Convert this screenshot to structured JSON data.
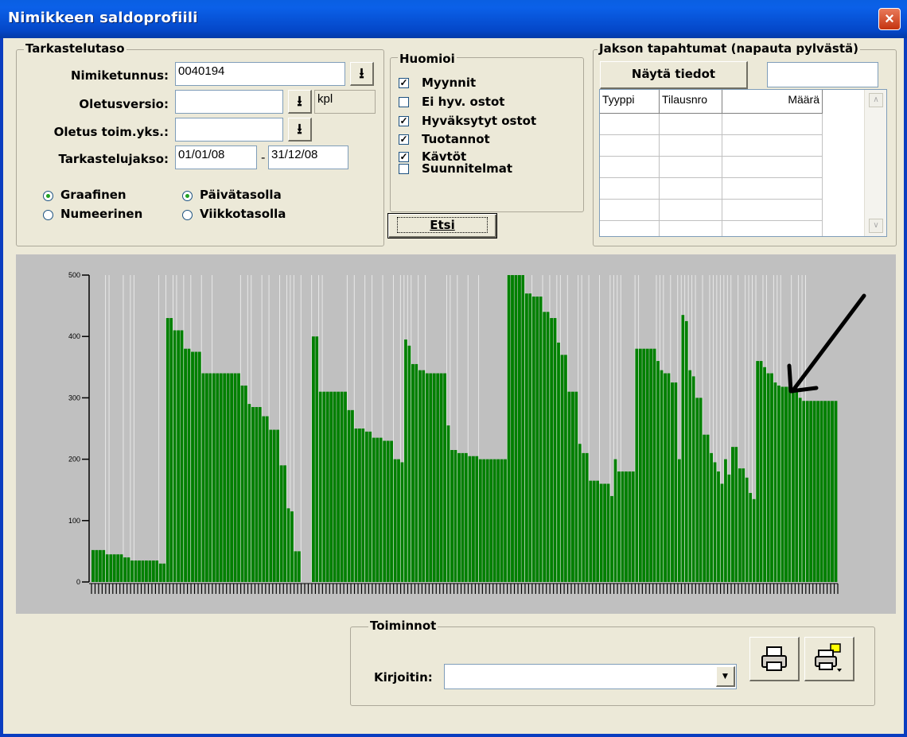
{
  "window": {
    "title": "Nimikkeen saldoprofiili",
    "close_glyph": "×"
  },
  "tarkastelutaso": {
    "legend": "Tarkastelutaso",
    "nimiketunnus_label": "Nimiketunnus:",
    "nimiketunnus_value": "0040194",
    "oletusversio_label": "Oletusversio:",
    "oletusversio_value": "",
    "unit_value": "kpl",
    "oletus_toimyks_label": "Oletus toim.yks.:",
    "oletus_toimyks_value": "",
    "jakso_label": "Tarkastelujakso:",
    "jakso_start": "01/01/08",
    "jakso_separator": "-",
    "jakso_end": "31/12/08",
    "radio_graafinen": "Graafinen",
    "radio_numeerinen": "Numeerinen",
    "radio_paivatasolla": "Päivätasolla",
    "radio_viikkotasolla": "Viikkotasolla",
    "selected_view": "Graafinen",
    "selected_level": "Päivätasolla",
    "download_glyph": "⭳"
  },
  "huomioi": {
    "legend": "Huomioi",
    "items": [
      {
        "label": "Myynnit",
        "checked": true
      },
      {
        "label": "Ei hyv. ostot",
        "checked": false
      },
      {
        "label": "Hyväksytyt ostot",
        "checked": true
      },
      {
        "label": "Tuotannot",
        "checked": true
      },
      {
        "label": "Kävtöt",
        "checked": true
      },
      {
        "label": "Suunnitelmat",
        "checked": false
      }
    ],
    "check_glyph": "✓",
    "search_button": "Etsi"
  },
  "jakson_tapahtumat": {
    "legend": "Jakson tapahtumat (napauta pylvästä)",
    "show_button": "Näytä tiedot",
    "info_value": "",
    "columns": [
      "Tyyppi",
      "Tilausnro",
      "Määrä"
    ],
    "rows": 6
  },
  "toiminnot": {
    "legend": "Toiminnot",
    "printer_label": "Kirjoitin:",
    "printer_value": "",
    "print_icon": "printer-icon",
    "printer_settings_icon": "printer-settings-icon"
  },
  "colors": {
    "bar": "#008000",
    "chart_bg": "#c0c0c0",
    "arrow": "#000000",
    "title_bar": "#0a5fe2"
  },
  "chart_data": {
    "type": "bar",
    "title": "",
    "xlabel": "",
    "ylabel": "",
    "ylim": [
      0,
      500
    ],
    "yticks": [
      "0",
      "100",
      "200",
      "300",
      "400",
      "500"
    ],
    "grid": false,
    "segments": [
      {
        "days": 4,
        "value": 52
      },
      {
        "days": 1,
        "value": 45
      },
      {
        "days": 4,
        "value": 45
      },
      {
        "days": 2,
        "value": 40
      },
      {
        "days": 1,
        "value": 35
      },
      {
        "days": 7,
        "value": 35
      },
      {
        "days": 2,
        "value": 30
      },
      {
        "days": 2,
        "value": 430
      },
      {
        "days": 1,
        "value": 410
      },
      {
        "days": 2,
        "value": 410
      },
      {
        "days": 2,
        "value": 380
      },
      {
        "days": 3,
        "value": 375
      },
      {
        "days": 3,
        "value": 340
      },
      {
        "days": 8,
        "value": 340
      },
      {
        "days": 2,
        "value": 320
      },
      {
        "days": 1,
        "value": 290
      },
      {
        "days": 3,
        "value": 285
      },
      {
        "days": 2,
        "value": 270
      },
      {
        "days": 3,
        "value": 248
      },
      {
        "days": 2,
        "value": 190
      },
      {
        "days": 1,
        "value": 120
      },
      {
        "days": 1,
        "value": 115
      },
      {
        "days": 2,
        "value": 50
      },
      {
        "days": 3,
        "value": 0
      },
      {
        "days": 2,
        "value": 400
      },
      {
        "days": 1,
        "value": 310
      },
      {
        "days": 7,
        "value": 310
      },
      {
        "days": 2,
        "value": 280
      },
      {
        "days": 3,
        "value": 250
      },
      {
        "days": 2,
        "value": 245
      },
      {
        "days": 3,
        "value": 235
      },
      {
        "days": 3,
        "value": 230
      },
      {
        "days": 2,
        "value": 200
      },
      {
        "days": 1,
        "value": 195
      },
      {
        "days": 1,
        "value": 395
      },
      {
        "days": 1,
        "value": 385
      },
      {
        "days": 2,
        "value": 355
      },
      {
        "days": 2,
        "value": 345
      },
      {
        "days": 6,
        "value": 340
      },
      {
        "days": 1,
        "value": 255
      },
      {
        "days": 2,
        "value": 215
      },
      {
        "days": 3,
        "value": 210
      },
      {
        "days": 3,
        "value": 205
      },
      {
        "days": 8,
        "value": 200
      },
      {
        "days": 5,
        "value": 500
      },
      {
        "days": 2,
        "value": 470
      },
      {
        "days": 3,
        "value": 465
      },
      {
        "days": 2,
        "value": 440
      },
      {
        "days": 2,
        "value": 430
      },
      {
        "days": 1,
        "value": 390
      },
      {
        "days": 2,
        "value": 370
      },
      {
        "days": 3,
        "value": 310
      },
      {
        "days": 1,
        "value": 225
      },
      {
        "days": 2,
        "value": 210
      },
      {
        "days": 3,
        "value": 165
      },
      {
        "days": 3,
        "value": 160
      },
      {
        "days": 1,
        "value": 140
      },
      {
        "days": 1,
        "value": 200
      },
      {
        "days": 1,
        "value": 180
      },
      {
        "days": 4,
        "value": 180
      },
      {
        "days": 1,
        "value": 380
      },
      {
        "days": 5,
        "value": 380
      },
      {
        "days": 1,
        "value": 360
      },
      {
        "days": 1,
        "value": 345
      },
      {
        "days": 2,
        "value": 340
      },
      {
        "days": 2,
        "value": 325
      },
      {
        "days": 1,
        "value": 200
      },
      {
        "days": 1,
        "value": 435
      },
      {
        "days": 1,
        "value": 425
      },
      {
        "days": 1,
        "value": 345
      },
      {
        "days": 1,
        "value": 335
      },
      {
        "days": 2,
        "value": 300
      },
      {
        "days": 2,
        "value": 240
      },
      {
        "days": 1,
        "value": 210
      },
      {
        "days": 1,
        "value": 195
      },
      {
        "days": 1,
        "value": 180
      },
      {
        "days": 1,
        "value": 160
      },
      {
        "days": 1,
        "value": 200
      },
      {
        "days": 1,
        "value": 175
      },
      {
        "days": 2,
        "value": 220
      },
      {
        "days": 2,
        "value": 185
      },
      {
        "days": 1,
        "value": 170
      },
      {
        "days": 1,
        "value": 145
      },
      {
        "days": 1,
        "value": 135
      },
      {
        "days": 2,
        "value": 360
      },
      {
        "days": 1,
        "value": 350
      },
      {
        "days": 2,
        "value": 340
      },
      {
        "days": 1,
        "value": 325
      },
      {
        "days": 1,
        "value": 320
      },
      {
        "days": 3,
        "value": 318
      },
      {
        "days": 2,
        "value": 310
      },
      {
        "days": 1,
        "value": 300
      },
      {
        "days": 1,
        "value": 295
      },
      {
        "days": 9,
        "value": 295
      }
    ]
  }
}
